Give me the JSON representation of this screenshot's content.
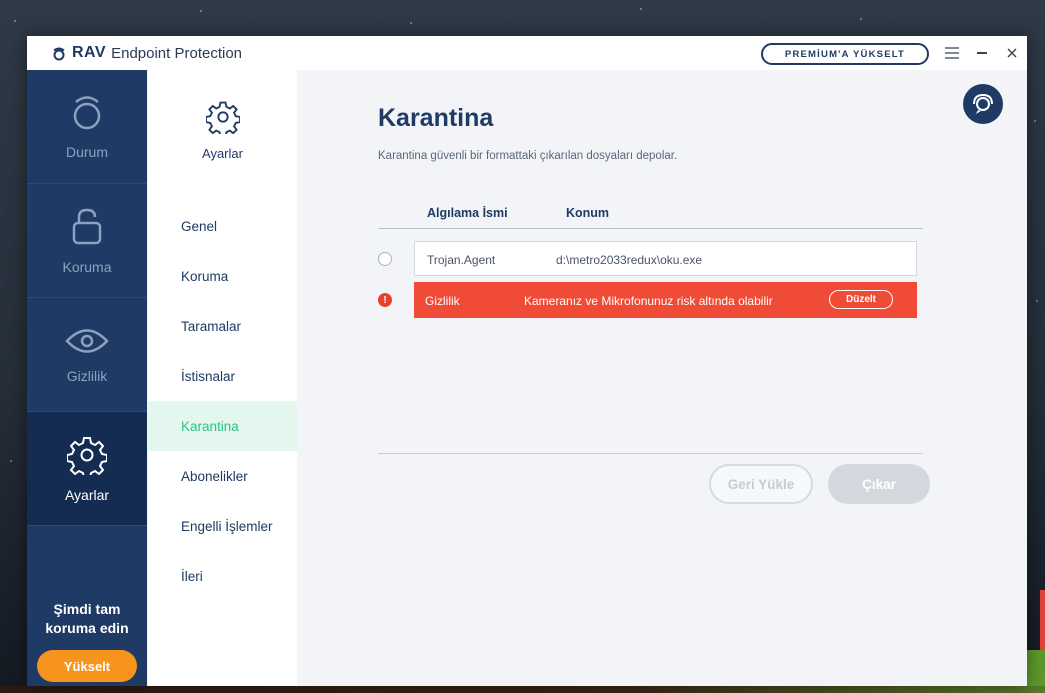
{
  "app": {
    "logo_brand": "RAV",
    "logo_product": "Endpoint Protection",
    "premium_label": "PREMİUM'A YÜKSELT"
  },
  "sidebar": {
    "items": [
      {
        "label": "Durum",
        "icon": "status-ring-icon"
      },
      {
        "label": "Koruma",
        "icon": "lock-icon"
      },
      {
        "label": "Gizlilik",
        "icon": "eye-icon"
      },
      {
        "label": "Ayarlar",
        "icon": "gear-icon"
      }
    ],
    "promo_line1": "Şimdi tam",
    "promo_line2": "koruma edin",
    "upgrade_label": "Yükselt"
  },
  "subnav": {
    "header": "Ayarlar",
    "items": [
      {
        "label": "Genel"
      },
      {
        "label": "Koruma"
      },
      {
        "label": "Taramalar"
      },
      {
        "label": "İstisnalar"
      },
      {
        "label": "Karantina"
      },
      {
        "label": "Abonelikler"
      },
      {
        "label": "Engelli İşlemler"
      },
      {
        "label": "İleri"
      }
    ]
  },
  "main": {
    "title": "Karantina",
    "description": "Karantina güvenli bir formattaki çıkarılan dosyaları depolar.",
    "columns": {
      "detection": "Algılama İsmi",
      "location": "Konum"
    },
    "rows": [
      {
        "name": "Trojan.Agent",
        "path": "d:\\metro2033redux\\oku.exe"
      }
    ],
    "alert": {
      "name": "Gizlilik",
      "message": "Kameranız ve Mikrofonunuz risk altında olabilir",
      "action": "Düzelt"
    },
    "restore_label": "Geri Yükle",
    "remove_label": "Çıkar"
  },
  "colors": {
    "navy": "#1f3a64",
    "accent_green": "#2ec486",
    "alert_red": "#f04b36",
    "upgrade_orange": "#f7941d"
  }
}
